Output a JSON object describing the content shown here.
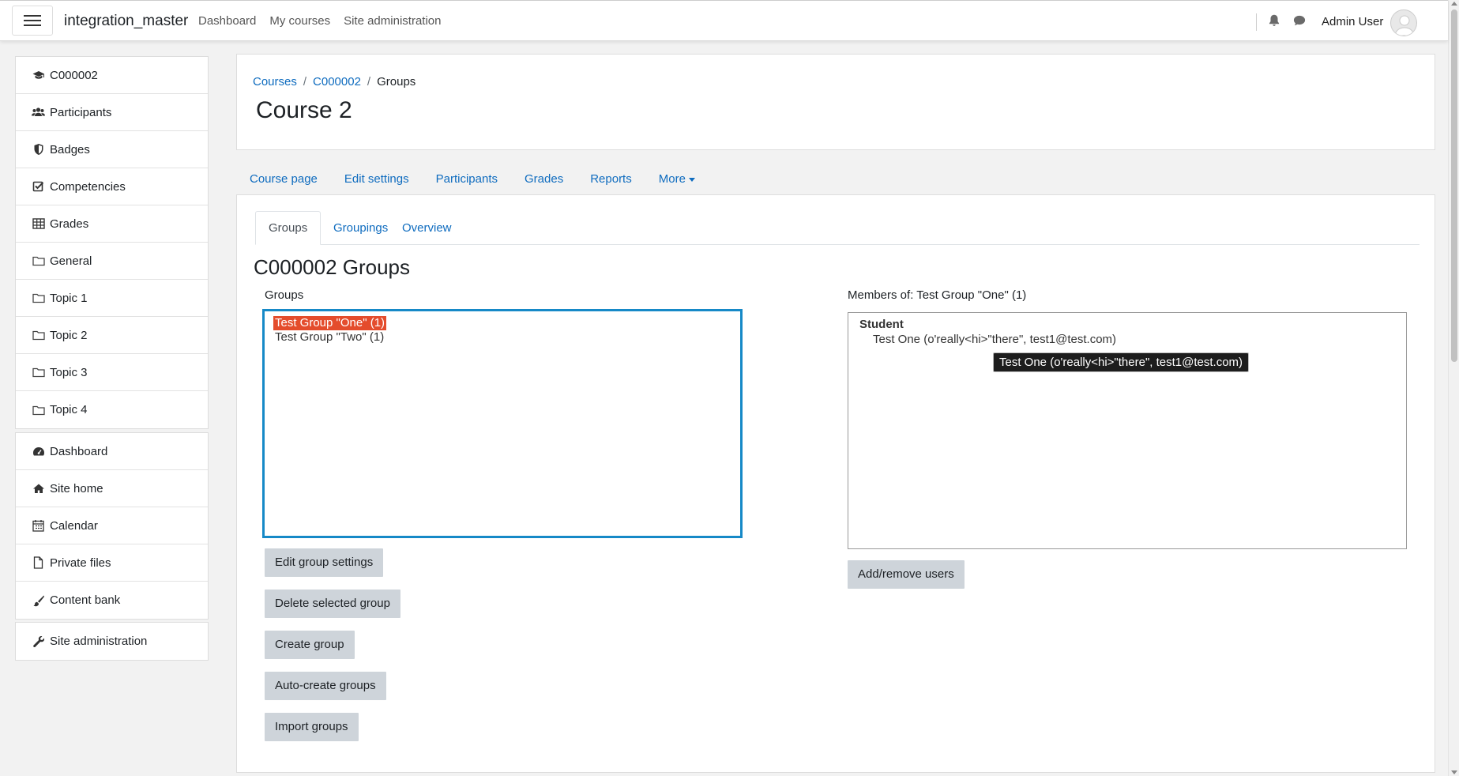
{
  "navbar": {
    "brand": "integration_master",
    "links": [
      "Dashboard",
      "My courses",
      "Site administration"
    ],
    "user_name": "Admin User",
    "icons": [
      "bell-icon",
      "chat-icon"
    ]
  },
  "sidebar": {
    "course_items": [
      {
        "label": "C000002",
        "icon": "graduation-cap-icon"
      },
      {
        "label": "Participants",
        "icon": "users-icon"
      },
      {
        "label": "Badges",
        "icon": "shield-icon"
      },
      {
        "label": "Competencies",
        "icon": "check-square-icon"
      },
      {
        "label": "Grades",
        "icon": "table-icon"
      },
      {
        "label": "General",
        "icon": "folder-icon"
      },
      {
        "label": "Topic 1",
        "icon": "folder-icon"
      },
      {
        "label": "Topic 2",
        "icon": "folder-icon"
      },
      {
        "label": "Topic 3",
        "icon": "folder-icon"
      },
      {
        "label": "Topic 4",
        "icon": "folder-icon"
      }
    ],
    "site_items": [
      {
        "label": "Dashboard",
        "icon": "dashboard-icon"
      },
      {
        "label": "Site home",
        "icon": "home-icon"
      },
      {
        "label": "Calendar",
        "icon": "calendar-icon"
      },
      {
        "label": "Private files",
        "icon": "file-icon"
      },
      {
        "label": "Content bank",
        "icon": "brush-icon"
      }
    ],
    "admin_item": {
      "label": "Site administration",
      "icon": "wrench-icon"
    }
  },
  "header": {
    "breadcrumb": [
      "Courses",
      "C000002",
      "Groups"
    ],
    "title": "Course 2"
  },
  "secondary_nav": [
    "Course page",
    "Edit settings",
    "Participants",
    "Grades",
    "Reports",
    "More"
  ],
  "tabs": [
    "Groups",
    "Groupings",
    "Overview"
  ],
  "section_title": "C000002 Groups",
  "groups_panel": {
    "label": "Groups",
    "options": [
      "Test Group \"One\" (1)",
      "Test Group \"Two\" (1)"
    ],
    "selected_index": 0,
    "buttons": [
      "Edit group settings",
      "Delete selected group",
      "Create group",
      "Auto-create groups",
      "Import groups"
    ]
  },
  "members_panel": {
    "label": "Members of: Test Group \"One\" (1)",
    "role": "Student",
    "member": "Test One (o'really<hi>\"there\", test1@test.com)",
    "button": "Add/remove users"
  },
  "tooltip": "Test One (o'really<hi>\"there\", test1@test.com)",
  "colors": {
    "link": "#0f6cbf",
    "selected_option": "#e44c2c",
    "focus_border": "#1689c7",
    "button_bg": "#ced4da"
  }
}
